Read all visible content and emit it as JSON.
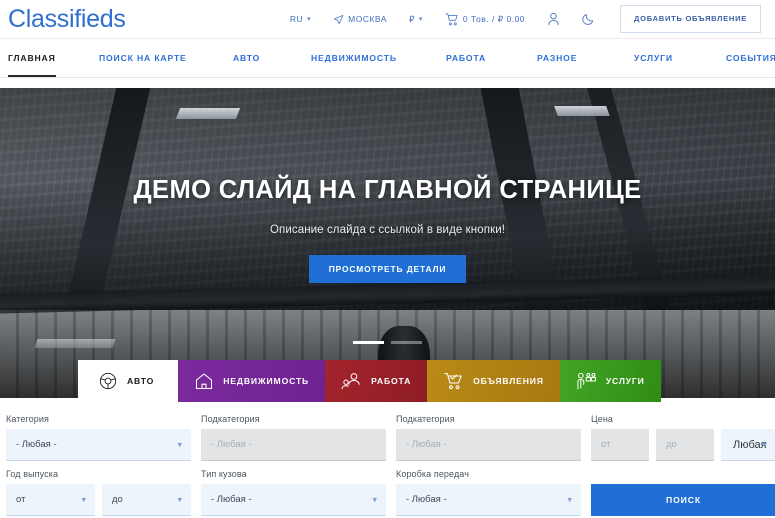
{
  "header": {
    "brand": "Classifieds",
    "language": "RU",
    "city": "МОСКВА",
    "currency": "₽",
    "cart": "0 Тов. / ₽ 0.00",
    "account_icon": "user-icon",
    "theme_icon": "moon-icon",
    "add_listing": "ДОБАВИТЬ ОБЪЯВЛЕНИЕ"
  },
  "nav": {
    "items": [
      {
        "label": "ГЛАВНАЯ",
        "active": true
      },
      {
        "label": "ПОИСК НА КАРТЕ",
        "active": false
      },
      {
        "label": "АВТО",
        "active": false
      },
      {
        "label": "НЕДВИЖИМОСТЬ",
        "active": false
      },
      {
        "label": "РАБОТА",
        "active": false
      },
      {
        "label": "РАЗНОЕ",
        "active": false
      },
      {
        "label": "УСЛУГИ",
        "active": false
      },
      {
        "label": "СОБЫТИЯ",
        "active": false
      }
    ]
  },
  "hero": {
    "title": "ДЕМО СЛАЙД НА ГЛАВНОЙ СТРАНИЦЕ",
    "subtitle": "Описание слайда с ссылкой в виде кнопки!",
    "button": "ПРОСМОТРЕТЬ ДЕТАЛИ",
    "slides": 2,
    "active_slide": 1
  },
  "category_tabs": [
    {
      "label": "АВТО",
      "icon": "steering-wheel-icon",
      "color": "#ffffff",
      "active": true
    },
    {
      "label": "НЕДВИЖИМОСТЬ",
      "icon": "house-icon",
      "color": "#7b2a9e",
      "active": false
    },
    {
      "label": "РАБОТА",
      "icon": "people-icon",
      "color": "#a4232c",
      "active": false
    },
    {
      "label": "ОБЪЯВЛЕНИЯ",
      "icon": "cart-check-icon",
      "color": "#b98a16",
      "active": false
    },
    {
      "label": "УСЛУГИ",
      "icon": "service-person-icon",
      "color": "#43a524",
      "active": false
    }
  ],
  "search_form": {
    "category": {
      "label": "Категория",
      "value": "- Любая -"
    },
    "subcategory1": {
      "label": "Подкатегория",
      "value": "- Любая -",
      "disabled": true
    },
    "subcategory2": {
      "label": "Подкатегория",
      "value": "- Любая -",
      "disabled": true
    },
    "price": {
      "label": "Цена",
      "from_placeholder": "от",
      "to_placeholder": "до",
      "currency": "Любая"
    },
    "year": {
      "label": "Год выпуска",
      "from": "от",
      "to": "до"
    },
    "body_type": {
      "label": "Тип кузова",
      "value": "- Любая -"
    },
    "gearbox": {
      "label": "Коробка передач",
      "value": "- Любая -"
    },
    "search_button": "ПОИСК"
  }
}
